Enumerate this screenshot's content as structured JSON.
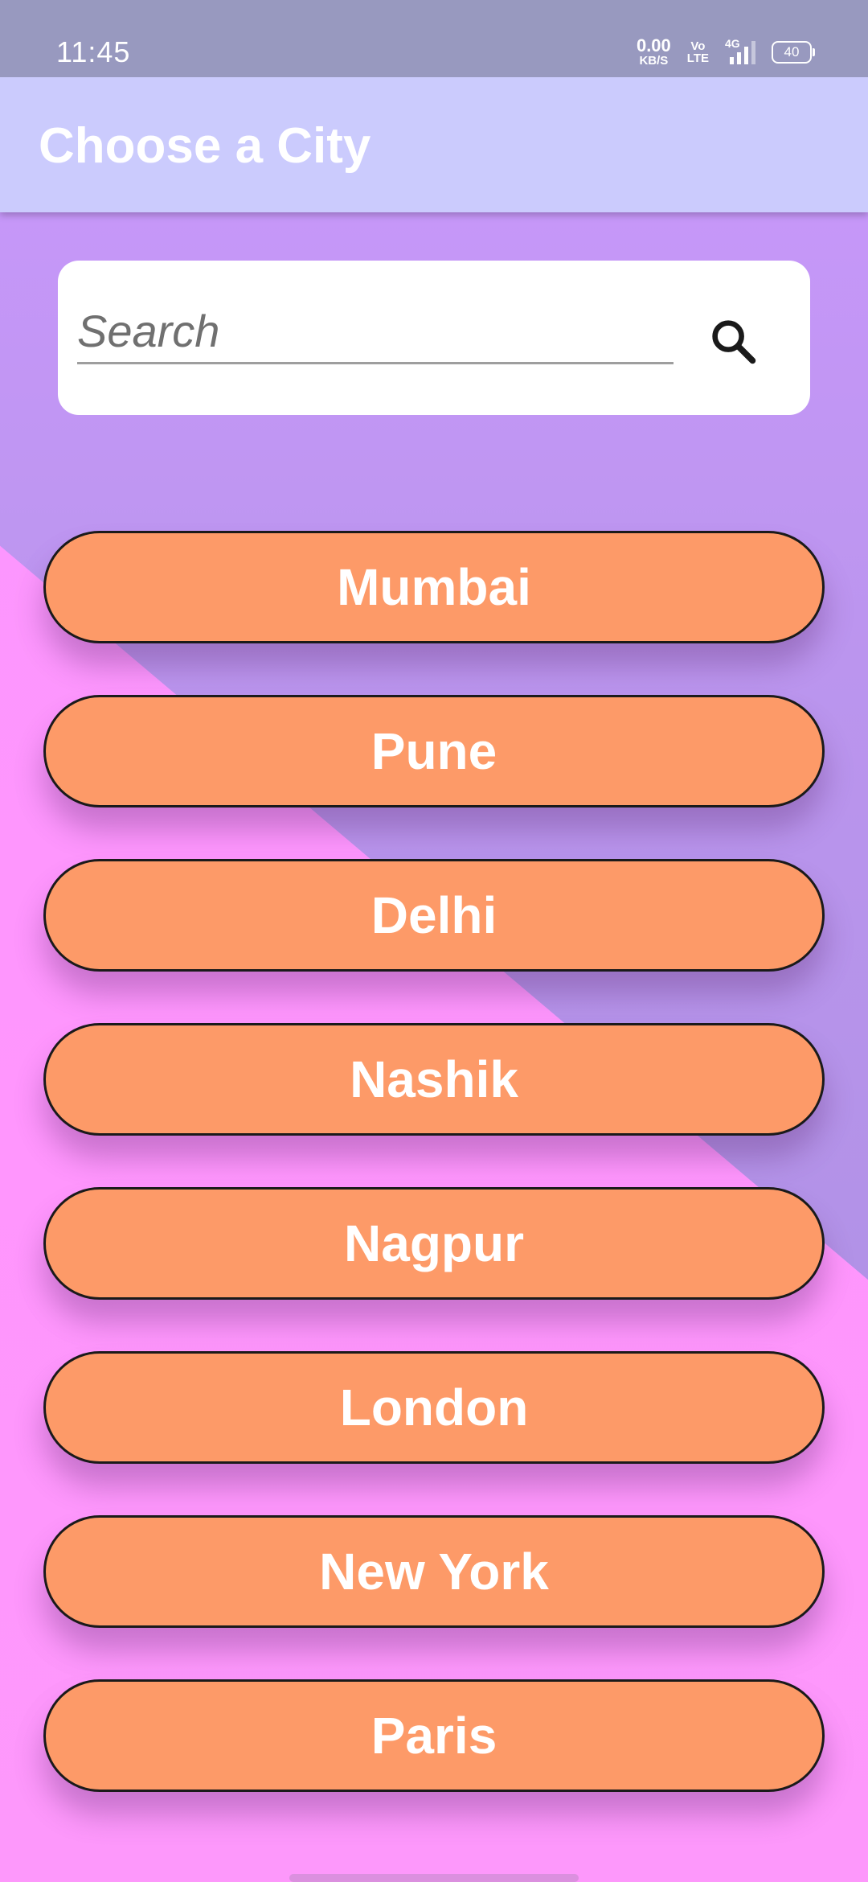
{
  "status_bar": {
    "time": "11:45",
    "net_speed_value": "0.00",
    "net_speed_unit": "KB/S",
    "volte_top": "Vo",
    "volte_bottom": "LTE",
    "network_type": "4G",
    "battery": "40",
    "signal_bars": 4,
    "signal_bars_filled": 3
  },
  "app_bar": {
    "title": "Choose a City"
  },
  "search": {
    "placeholder": "Search",
    "value": "",
    "icon": "search-icon"
  },
  "cities": [
    {
      "label": "Mumbai"
    },
    {
      "label": "Pune"
    },
    {
      "label": "Delhi"
    },
    {
      "label": "Nashik"
    },
    {
      "label": "Nagpur"
    },
    {
      "label": "London"
    },
    {
      "label": "New York"
    },
    {
      "label": "Paris"
    }
  ],
  "colors": {
    "status_bar": "#9899bf",
    "app_bar": "#cbcbfd",
    "background_top": "#cb98fd",
    "background_bottom": "#ff96fd",
    "button_fill": "#fd9a68",
    "button_border": "#1a1a1a",
    "text_on_button": "#ffffff"
  }
}
